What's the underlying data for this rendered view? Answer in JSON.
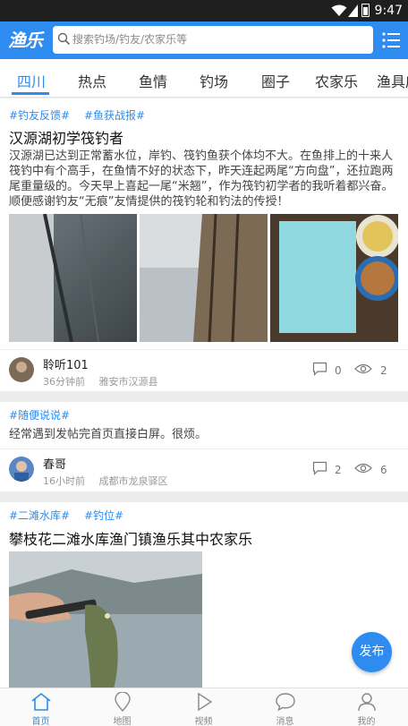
{
  "status": {
    "time": "9:47"
  },
  "header": {
    "logo": "渔乐",
    "search_placeholder": "搜索钓场/钓友/农家乐等",
    "brand_color": "#2e8cf0"
  },
  "tabs": [
    "四川",
    "热点",
    "鱼情",
    "钓场",
    "圈子",
    "农家乐",
    "渔具店"
  ],
  "posts": [
    {
      "tags": [
        "#钓友反馈#",
        "#鱼获战报#"
      ],
      "title": "汉源湖初学筏钓者",
      "body": "汉源湖已达到正常蓄水位，岸钓、筏钓鱼获个体均不大。在鱼排上的十来人筏钓中有个高手，在鱼情不好的状态下，昨天连起两尾“方向盘”，还拉跑两尾重量级的。今天早上喜起一尾“米翘”，作为筏钓初学者的我听着都兴奋。顺便感谢钓友“无痕”友情提供的筏钓轮和钓法的传授！",
      "author": "聆听101",
      "time": "36分钟前",
      "location": "雅安市汉源县",
      "comments": "0",
      "views": "2"
    },
    {
      "tags": [
        "#随便说说#"
      ],
      "body": "经常遇到发帖完首页直接白屏。很烦。",
      "author": "春哥",
      "time": "16小时前",
      "location": "成都市龙泉驿区",
      "comments": "2",
      "views": "6"
    },
    {
      "tags": [
        "#二滩水库#",
        "#钓位#"
      ],
      "title": "攀枝花二滩水库渔门镇渔乐其中农家乐"
    }
  ],
  "fab_label": "发布",
  "bottom_nav": [
    "首页",
    "地图",
    "视频",
    "消息",
    "我的"
  ]
}
